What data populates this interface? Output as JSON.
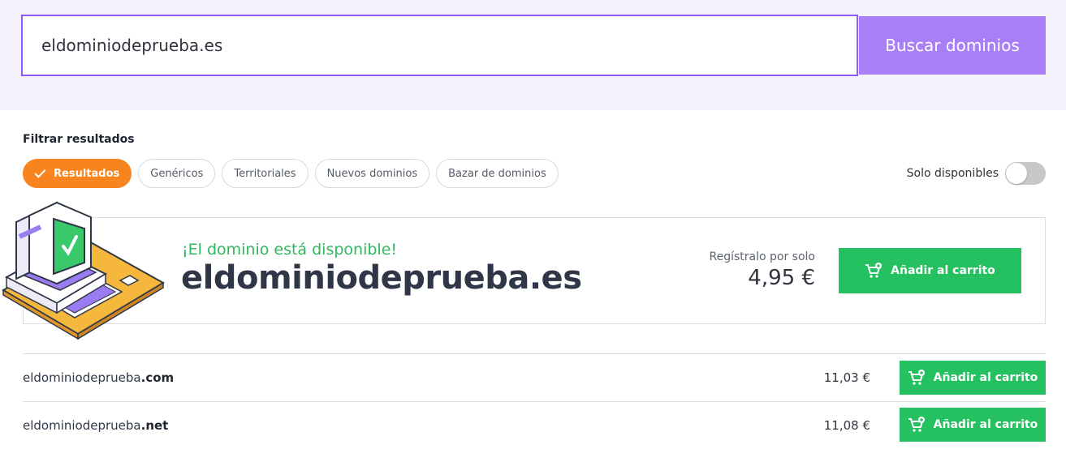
{
  "search": {
    "value": "eldominiodeprueba.es",
    "button_label": "Buscar dominios"
  },
  "filters": {
    "title": "Filtrar resultados",
    "chips": [
      "Resultados",
      "Genéricos",
      "Territoriales",
      "Nuevos dominios",
      "Bazar de dominios"
    ],
    "active": "Resultados",
    "only_available_label": "Solo disponibles",
    "only_available_on": false
  },
  "featured": {
    "availability": "¡El dominio está disponible!",
    "domain": "eldominiodeprueba.es",
    "register_label": "Regístralo por solo",
    "price": "4,95 €",
    "cart_label": "Añadir al carrito"
  },
  "results": [
    {
      "base": "eldominiodeprueba",
      "tld": ".com",
      "price": "11,03 €",
      "cart_label": "Añadir al carrito"
    },
    {
      "base": "eldominiodeprueba",
      "tld": ".net",
      "price": "11,08 €",
      "cart_label": "Añadir al carrito"
    }
  ],
  "colors": {
    "accent": "#8b5cf6",
    "search_button": "#a87ff7",
    "active_chip": "#f7841e",
    "success": "#2eb85c",
    "cart_button": "#25c160",
    "band_background": "#f4f1fd"
  },
  "icons": {
    "cart": "add-to-cart-icon",
    "check": "check-icon",
    "illustration": "computer-illustration"
  }
}
